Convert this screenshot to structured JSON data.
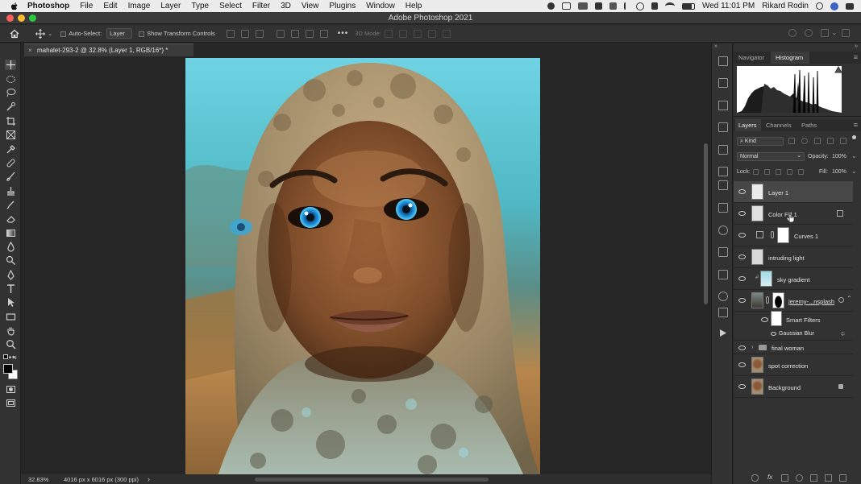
{
  "menubar": {
    "app_name": "Photoshop",
    "items": [
      "File",
      "Edit",
      "Image",
      "Layer",
      "Type",
      "Select",
      "Filter",
      "3D",
      "View",
      "Plugins",
      "Window",
      "Help"
    ],
    "clock": "Wed 11:01 PM",
    "user": "Rikard Rodin"
  },
  "window": {
    "title": "Adobe Photoshop 2021"
  },
  "options_bar": {
    "auto_select_label": "Auto-Select:",
    "auto_select_value": "Layer",
    "show_transform_label": "Show Transform Controls",
    "mode_3d_label": "3D Mode:"
  },
  "document": {
    "tab_label": "mahalet-293-2 @ 32.8% (Layer 1, RGB/16*) *",
    "close_glyph": "×"
  },
  "status_bar": {
    "zoom": "32.83%",
    "doc_info": "4016 px x 6016 px (300 ppi)",
    "arrow": "›"
  },
  "top_panel": {
    "tabs": [
      "Navigator",
      "Histogram"
    ],
    "active_tab": "Histogram"
  },
  "layers_panel": {
    "tabs": [
      "Layers",
      "Channels",
      "Paths"
    ],
    "active_tab": "Layers",
    "filter_kind": "Kind",
    "blend_mode": "Normal",
    "opacity_label": "Opacity:",
    "opacity_value": "100%",
    "lock_label": "Lock:",
    "fill_label": "Fill:",
    "fill_value": "100%",
    "layers": [
      {
        "name": "Layer 1",
        "selected": true
      },
      {
        "name": "Color Fill 1"
      },
      {
        "name": "Curves 1"
      },
      {
        "name": "intruding light"
      },
      {
        "name": "sky gradient"
      },
      {
        "name": "jeremy-...nsplash"
      },
      {
        "name": "Smart Filters"
      },
      {
        "name": "Gaussian Blur"
      },
      {
        "name": "final woman"
      },
      {
        "name": "spot correction"
      },
      {
        "name": "Background"
      }
    ]
  },
  "colors": {
    "eye_blue": "#1e8fd6",
    "sky_cyan": "#6fd3e3",
    "ui_dark": "#323232",
    "selected_row": "#474747"
  }
}
